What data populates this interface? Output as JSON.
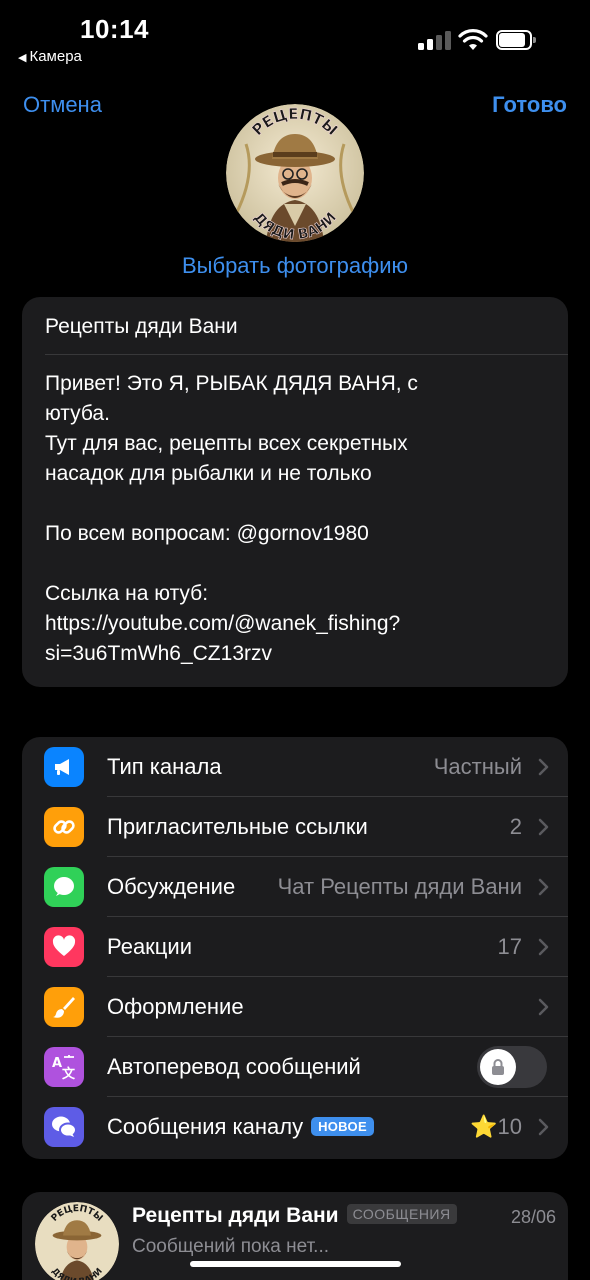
{
  "status_bar": {
    "time": "10:14",
    "back_app": "Камера"
  },
  "nav": {
    "cancel": "Отмена",
    "done": "Готово"
  },
  "avatar": {
    "logo_text_top": "РЕЦЕПТЫ",
    "logo_text_bottom": "ДЯДИ ВАНИ",
    "choose_photo": "Выбрать фотографию"
  },
  "channel": {
    "name": "Рецепты дяди Вани",
    "description": [
      "Привет!  Это Я, РЫБАК ДЯДЯ ВАНЯ, с\nютуба.\nТут для вас,  рецепты всех секретных\nнасадок для рыбалки и не только",
      "По всем вопросам: @gornov1980",
      "Ссылка на ютуб:\nhttps://youtube.com/@wanek_fishing?\nsi=3u6TmWh6_CZ13rzv"
    ]
  },
  "settings": [
    {
      "label": "Тип канала",
      "value": "Частный",
      "icon": "megaphone-icon",
      "color": "#0a84ff"
    },
    {
      "label": "Пригласительные ссылки",
      "value": "2",
      "icon": "link-icon",
      "color": "#ff9f0a"
    },
    {
      "label": "Обсуждение",
      "value": "Чат Рецепты дяди Вани",
      "icon": "chat-bubble-icon",
      "color": "#30d158"
    },
    {
      "label": "Реакции",
      "value": "17",
      "icon": "heart-icon",
      "color": "#ff375f"
    },
    {
      "label": "Оформление",
      "value": "",
      "icon": "brush-icon",
      "color": "#ff9f0a"
    },
    {
      "label": "Автоперевод сообщений",
      "value": "",
      "icon": "translate-icon",
      "color": "#af52de",
      "toggle": false
    },
    {
      "label": "Сообщения каналу",
      "badge": "НОВОЕ",
      "value": "10",
      "icon": "messages-icon",
      "color": "#5e5ce6"
    }
  ],
  "chat_preview": {
    "title": "Рецепты дяди Вани",
    "tag": "СООБЩЕНИЯ",
    "date": "28/06",
    "preview": "Сообщений пока нет..."
  },
  "colors": {
    "accent": "#3e8fee",
    "card": "#1c1c1e",
    "secondary_text": "#8d8d93"
  }
}
